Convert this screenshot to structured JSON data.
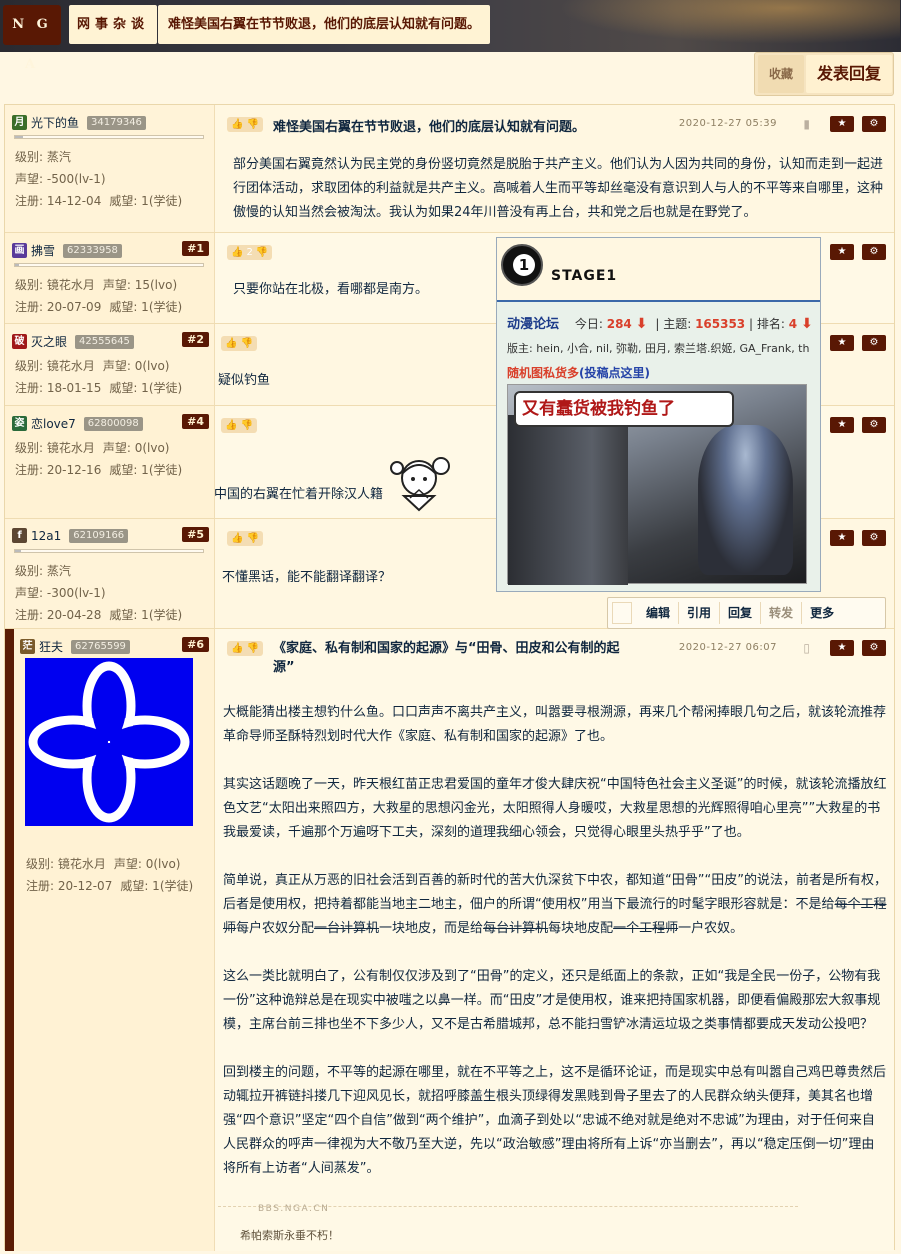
{
  "header": {
    "logo": "N G A",
    "breadcrumb_forum": "网事杂谈",
    "thread_title": "难怪美国右翼在节节败退，他们的底层认知就有问题。"
  },
  "actions": {
    "favorite": "收藏",
    "reply": "发表回复"
  },
  "posts": [
    {
      "avatar_char": "月",
      "avatar_color": "#3a6e2a",
      "username": "光下的鱼",
      "uid": "34179346",
      "floor": "",
      "level": "级别: 蒸汽",
      "fame": "声望: -500(lv-1)",
      "reg": "注册: 14-12-04",
      "auth": "威望: 1(学徒)",
      "title": "难怪美国右翼在节节败退，他们的底层认知就有问题。",
      "date": "2020-12-27 05:39",
      "content": "部分美国右翼竟然认为民主党的身份竖切竟然是脱胎于共产主义。他们认为人因为共同的身份，认知而走到一起进行团体活动，求取团体的利益就是共产主义。高喊着人生而平等却丝毫没有意识到人与人的不平等来自哪里，这种傲慢的认知当然会被淘汰。我认为如果24年川普没有再上台，共和党之后也就是在野党了。"
    },
    {
      "avatar_char": "画",
      "avatar_color": "#5a3a9a",
      "username": "拂雪",
      "uid": "62333958",
      "floor": "#1",
      "level": "级别: 镜花水月",
      "fame": "声望: 15(lvo)",
      "reg": "注册: 20-07-09",
      "auth": "威望: 1(学徒)",
      "vote_count": "2",
      "content": "只要你站在北极，看哪都是南方。"
    },
    {
      "avatar_char": "破",
      "avatar_color": "#a01818",
      "username": "灭之眼",
      "uid": "42555645",
      "floor": "#2",
      "level": "级别: 镜花水月",
      "fame": "声望: 0(lvo)",
      "reg": "注册: 18-01-15",
      "auth": "威望: 1(学徒)",
      "content": "疑似钓鱼"
    },
    {
      "avatar_char": "姿",
      "avatar_color": "#2a6a3a",
      "username": "恋love7",
      "uid": "62800098",
      "floor": "#4",
      "level": "级别: 镜花水月",
      "fame": "声望: 0(lvo)",
      "reg": "注册: 20-12-16",
      "auth": "威望: 1(学徒)",
      "content": "中国的右翼在忙着开除汉人籍"
    },
    {
      "avatar_char": "f",
      "avatar_color": "#5c4632",
      "username": "12a1",
      "uid": "62109166",
      "floor": "#5",
      "level": "级别: 蒸汽",
      "fame": "声望: -300(lv-1)",
      "reg": "注册: 20-04-28",
      "auth": "威望: 1(学徒)",
      "content": "不懂黑话，能不能翻译翻译？"
    },
    {
      "avatar_char": "茫",
      "avatar_color": "#7a5a2a",
      "username": "狂夫",
      "uid": "62765599",
      "floor": "#6",
      "level": "级别: 镜花水月",
      "fame": "声望: 0(lvo)",
      "reg": "注册: 20-12-07",
      "auth": "威望: 1(学徒)",
      "title_line1": "《家庭、私有制和国家的起源》与“田骨、田皮和公有制的起",
      "title_line2": "源”",
      "date": "2020-12-27 06:07",
      "p1": "大概能猜出楼主想钓什么鱼。口口声声不离共产主义，叫嚣要寻根溯源，再来几个帮闲捧眼几句之后，就该轮流推荐革命导师圣酥特烈划时代大作《家庭、私有制和国家的起源》了也。",
      "p2": "其实这话题晚了一天，昨天根红苗正忠君爱国的童年才俊大肆庆祝“中国特色社会主义圣诞”的时候，就该轮流播放红色文艺“太阳出来照四方，大救星的思想闪金光，太阳照得人身暖哎，大救星思想的光辉照得咱心里亮””大救星的书我最爱读，千遍那个万遍呀下工夫，深刻的道理我细心领会，只觉得心眼里头热乎乎”了也。",
      "p3a": "简单说，真正从万恶的旧社会活到百善的新时代的苦大仇深贫下中农，都知道“田骨”“田皮”的说法，前者是所有权，后者是使用权，把持着都能当地主二地主，佃户的所谓“使用权”用当下最流行的时髦字眼形容就是：不是给",
      "p3s1": "每个工程师",
      "p3b": "每户农奴分配",
      "p3s2": "一台计算机",
      "p3c": "一块地皮，而是给",
      "p3s3": "每台计算机",
      "p3d": "每块地皮配",
      "p3s4": "一个工程师",
      "p3e": "一户农奴。",
      "p4": "这么一类比就明白了，公有制仅仅涉及到了“田骨”的定义，还只是纸面上的条款，正如“我是全民一份子，公物有我一份”这种诡辩总是在现实中被嗤之以鼻一样。而“田皮”才是使用权，谁来把持国家机器，即便看偏殿那宏大叙事规模，主席台前三排也坐不下多少人，又不是古希腊城邦，总不能扫雪铲冰清运垃圾之类事情都要成天发动公投吧？",
      "p5": "回到楼主的问题，不平等的起源在哪里，就在不平等之上，这不是循环论证，而是现实中总有叫嚣自己鸡巴尊贵然后动辄拉开裤链抖搂几下迎风见长，就招呼膝盖生根头顶绿得发黑贱到骨子里去了的人民群众纳头便拜，美其名也增强“四个意识”坚定“四个自信”做到“两个维护”，血滴子到处以“忠诚不绝对就是绝对不忠诚”为理由，对于任何来自人民群众的呼声一律视为大不敬乃至大逆，先以“政治敏感”理由将所有上诉“亦当删去”，再以“稳定压倒一切”理由将所有上访者“人间蒸发”。",
      "sig_watermark": "BBS.NGA.CN",
      "signature": "希帕索斯永垂不朽！"
    }
  ],
  "overlay": {
    "stage_number": "1",
    "stage_label": "STAGE1",
    "forum_name": "动漫论坛",
    "today_label": "今日:",
    "today_value": "284",
    "topics_label": "主题:",
    "topics_value": "165353",
    "rank_label": "排名:",
    "rank_value": "4",
    "moderators": "版主: hein, 小合, nil, 弥勒, 田月, 索兰塔.织姬, GA_Frank, th",
    "random_pic": "随机图私货多",
    "submit": "(投稿点这里)",
    "meme_text": "又有蠢货被我钓鱼了"
  },
  "operations": [
    "编辑",
    "引用",
    "回复",
    "转发",
    "更多"
  ],
  "colors": {
    "brand": "#591804",
    "bg": "#fff7e3",
    "avatar6": "#0000f0"
  }
}
